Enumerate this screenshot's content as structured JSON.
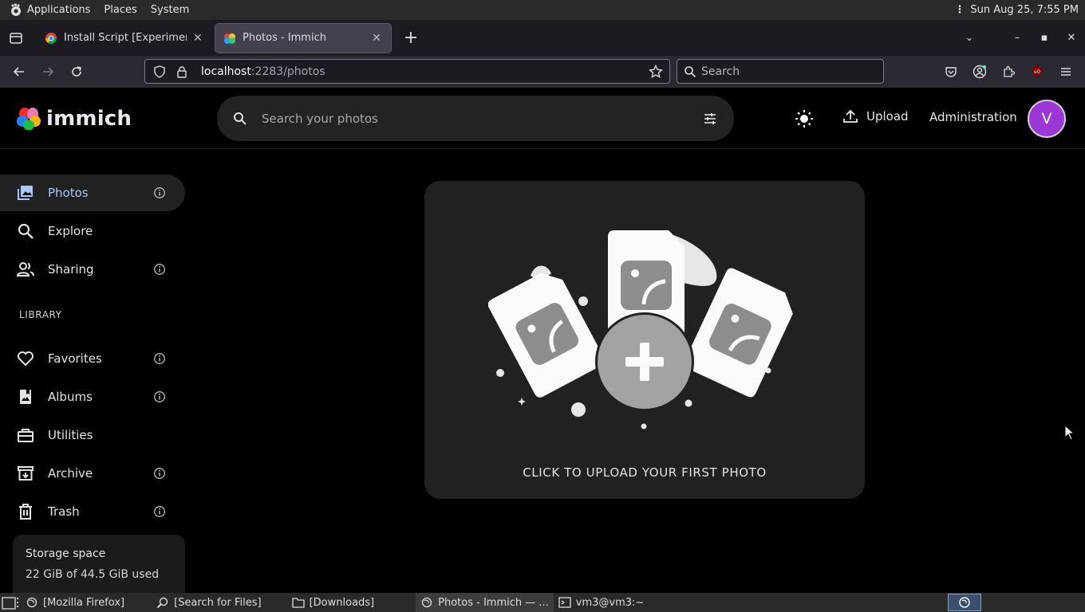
{
  "os_top": {
    "menu": [
      "Applications",
      "Places",
      "System"
    ],
    "datetime": "Sun Aug 25,  7:55 PM"
  },
  "browser": {
    "tabs": [
      {
        "title": "Install Script [Experimental]",
        "active": false
      },
      {
        "title": "Photos - Immich",
        "active": true
      }
    ],
    "url_host": "localhost",
    "url_rest": ":2283/photos",
    "search_placeholder": "Search"
  },
  "app": {
    "brand": "immich",
    "search_placeholder": "Search your photos",
    "upload_label": "Upload",
    "admin_label": "Administration",
    "avatar_initial": "V",
    "avatar_color": "#9b37d6",
    "sidebar": {
      "items": [
        {
          "label": "Photos",
          "icon": "photos-icon",
          "info": true,
          "active": true
        },
        {
          "label": "Explore",
          "icon": "explore-icon",
          "info": false
        },
        {
          "label": "Sharing",
          "icon": "sharing-icon",
          "info": true
        }
      ],
      "library_heading": "LIBRARY",
      "library_items": [
        {
          "label": "Favorites",
          "icon": "heart-icon",
          "info": true
        },
        {
          "label": "Albums",
          "icon": "albums-icon",
          "info": true
        },
        {
          "label": "Utilities",
          "icon": "toolbox-icon",
          "info": false
        },
        {
          "label": "Archive",
          "icon": "archive-icon",
          "info": true
        },
        {
          "label": "Trash",
          "icon": "trash-icon",
          "info": true
        }
      ],
      "storage_title": "Storage space",
      "storage_value": "22 GiB of 44.5 GiB used"
    },
    "empty_state_cta": "CLICK TO UPLOAD YOUR FIRST PHOTO"
  },
  "taskbar": {
    "items": [
      {
        "label": "[Mozilla Firefox]",
        "icon": "firefox-icon"
      },
      {
        "label": "[Search for Files]",
        "icon": "search-files-icon"
      },
      {
        "label": "[Downloads]",
        "icon": "folder-icon"
      },
      {
        "label": "Photos - Immich — ...",
        "icon": "firefox-icon",
        "active": true
      },
      {
        "label": "vm3@vm3:~",
        "icon": "terminal-icon"
      }
    ]
  }
}
